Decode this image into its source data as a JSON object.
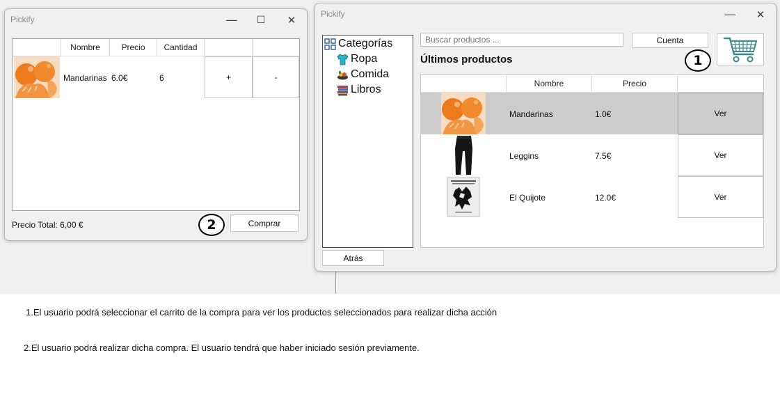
{
  "cart_window": {
    "title": "Pickify",
    "controls": [
      "—",
      "☐",
      "✕"
    ],
    "columns": [
      "",
      "Nombre",
      "Precio",
      "Cantidad",
      "",
      ""
    ],
    "rows": [
      {
        "image": "mandarin-image",
        "name": "Mandarinas",
        "price": "6.0€",
        "quantity": "6",
        "plus_label": "+",
        "minus_label": "-"
      }
    ],
    "total_label": "Precio Total: 6,00 €",
    "buy_label": "Comprar",
    "badge": "2"
  },
  "store_window": {
    "title": "Pickify",
    "controls": [
      "—",
      "✕"
    ],
    "categories": [
      {
        "label": "Categorías",
        "icon": "categories-icon"
      },
      {
        "label": "Ropa",
        "icon": "shirt-icon"
      },
      {
        "label": "Comida",
        "icon": "food-icon"
      },
      {
        "label": "Libros",
        "icon": "books-icon"
      }
    ],
    "search_placeholder": "Buscar productos ...",
    "account_label": "Cuenta",
    "cart_icon": "shopping-cart-icon",
    "badge": "1",
    "section_title": "Últimos productos",
    "columns": [
      "",
      "Nombre",
      "Precio",
      ""
    ],
    "products": [
      {
        "image": "mandarin-image",
        "name": "Mandarinas",
        "price": "1.0€",
        "action": "Ver",
        "selected": true
      },
      {
        "image": "leggings-image",
        "name": "Leggins",
        "price": "7.5€",
        "action": "Ver",
        "selected": false
      },
      {
        "image": "book-image",
        "name": "El Quijote",
        "price": "12.0€",
        "action": "Ver",
        "selected": false
      }
    ],
    "back_label": "Atrás"
  },
  "captions": [
    "1.El usuario podrá seleccionar el carrito de la compra para ver los productos seleccionados para realizar dicha acción",
    "2.El usuario podrá realizar dicha compra. El usuario tendrá que haber iniciado sesión previamente."
  ],
  "colors": {
    "selected_row": "#cccccc",
    "window_bg": "#f0f0f0",
    "panel_border": "#a0a0a0"
  }
}
